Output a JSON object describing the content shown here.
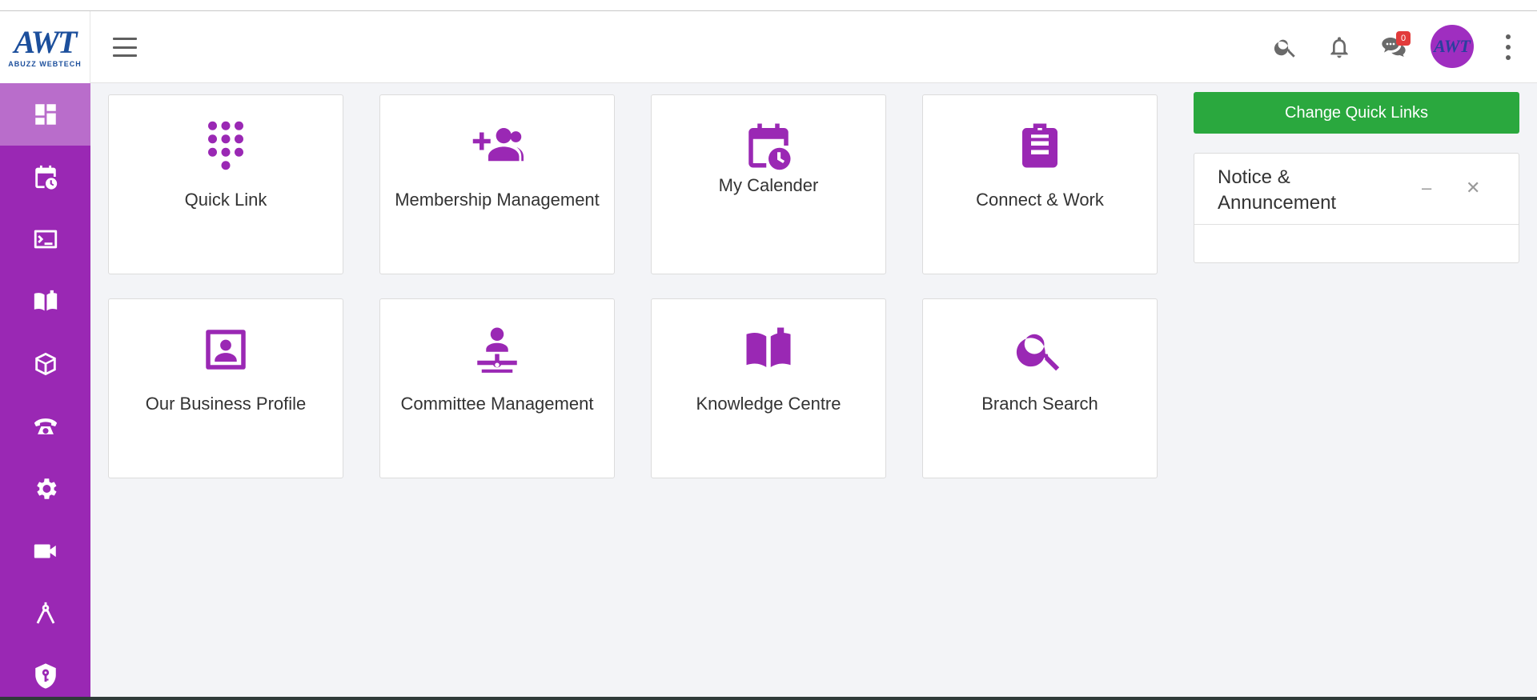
{
  "brand": {
    "logo_text": "AWT",
    "logo_sub": "ABUZZ WEBTECH",
    "avatar_text": "AWT"
  },
  "colors": {
    "primary": "#9a28b4",
    "sidebar_active": "#b96dcb",
    "quick_button": "#2aa83e",
    "badge": "#e23b3b"
  },
  "sidebar": {
    "items": [
      {
        "icon": "dashboard-icon"
      },
      {
        "icon": "calendar-clock-icon"
      },
      {
        "icon": "terminal-icon"
      },
      {
        "icon": "book-open-icon"
      },
      {
        "icon": "box-icon"
      },
      {
        "icon": "phone-icon"
      },
      {
        "icon": "gear-icon"
      },
      {
        "icon": "video-camera-icon"
      },
      {
        "icon": "compass-icon"
      },
      {
        "icon": "shield-key-icon"
      }
    ]
  },
  "header": {
    "chat_badge": "0"
  },
  "tiles": [
    {
      "label": "Quick Link",
      "icon": "dialpad-icon"
    },
    {
      "label": "Membership Management",
      "icon": "add-group-icon"
    },
    {
      "label": "My Calender",
      "icon": "calendar-clock-icon"
    },
    {
      "label": "Connect & Work",
      "icon": "clipboard-icon"
    },
    {
      "label": "Our Business Profile",
      "icon": "contact-card-icon"
    },
    {
      "label": "Committee Management",
      "icon": "network-person-icon"
    },
    {
      "label": "Knowledge Centre",
      "icon": "book-open-icon"
    },
    {
      "label": "Branch Search",
      "icon": "search-icon"
    }
  ],
  "quick_links_button": "Change Quick Links",
  "notice": {
    "title": "Notice & Annuncement",
    "minimize": "–",
    "close": "✕"
  }
}
